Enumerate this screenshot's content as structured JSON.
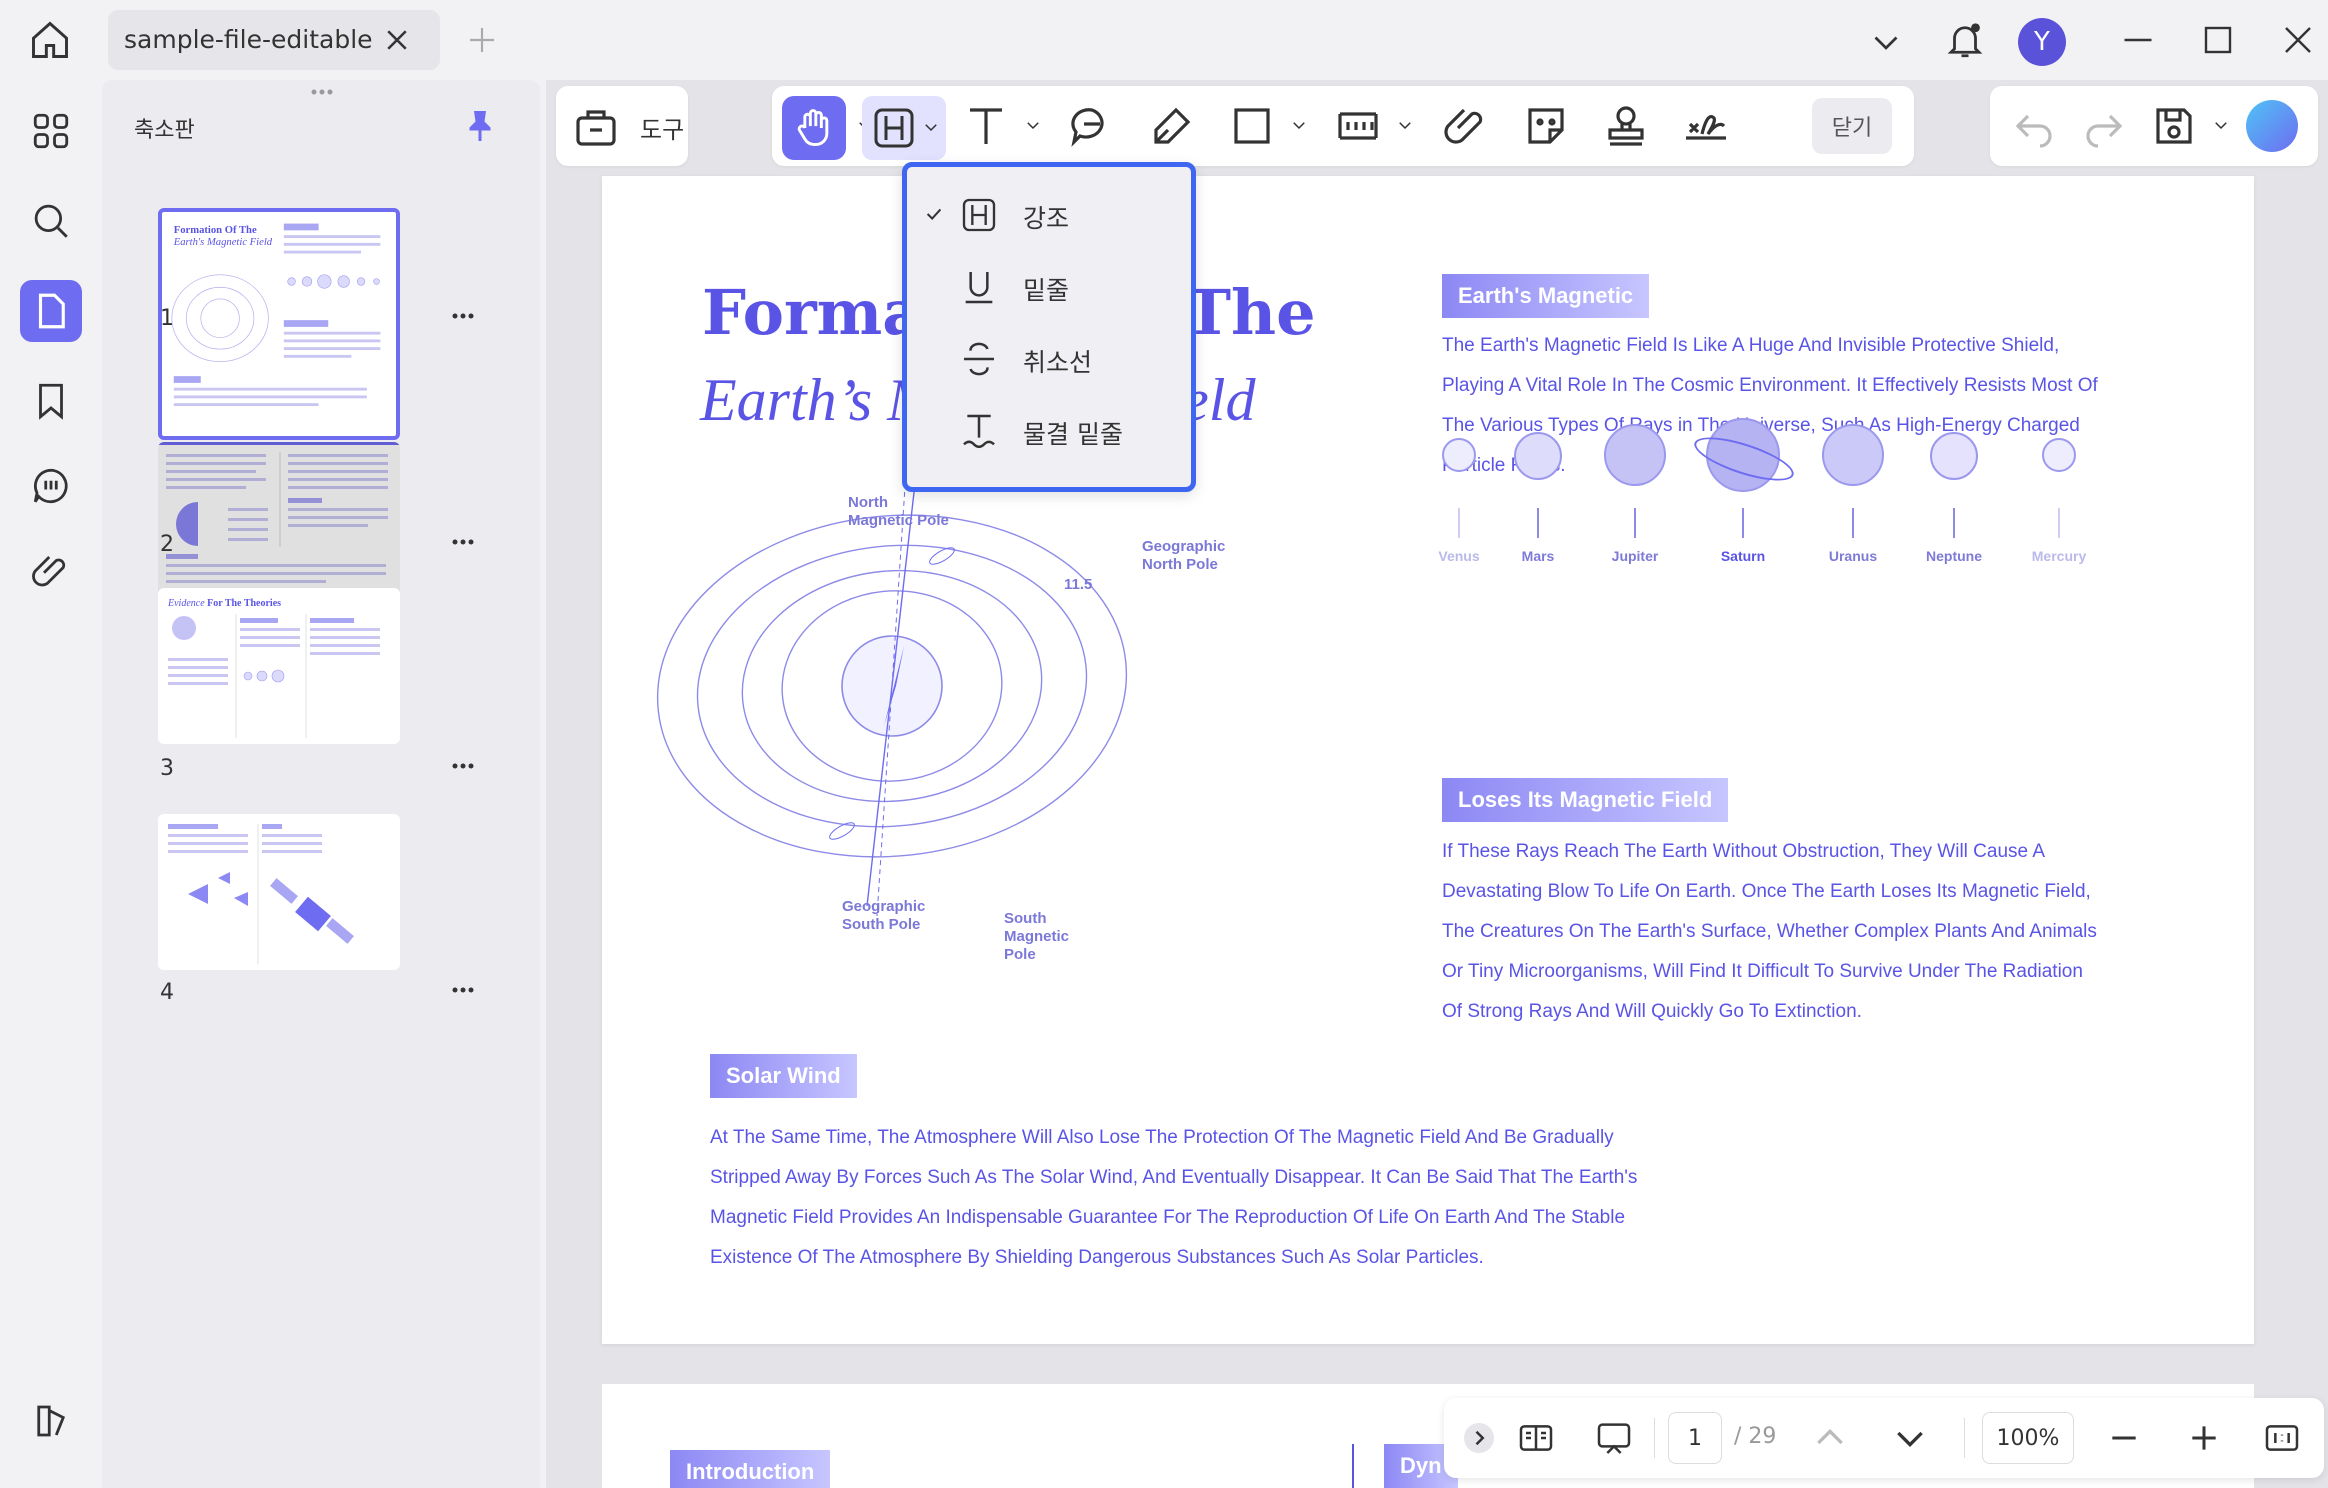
{
  "titlebar": {
    "tab_title": "sample-file-editable",
    "avatar_letter": "Y"
  },
  "panel": {
    "title": "축소판",
    "pages": [
      {
        "num": "1",
        "selected": true
      },
      {
        "num": "2",
        "selected": false
      },
      {
        "num": "3",
        "selected": false
      },
      {
        "num": "4",
        "selected": false
      }
    ],
    "thumb3_heading_a": "Evidence",
    "thumb3_heading_b": "For The Theories",
    "thumb1_heading_a": "Formation Of The",
    "thumb1_heading_b": "Earth's Magnetic Field"
  },
  "toolbar": {
    "tools_label": "도구",
    "close_label": "닫기"
  },
  "highlight_menu": {
    "items": [
      {
        "label": "강조",
        "checked": true,
        "icon": "highlight-h-icon"
      },
      {
        "label": "밑줄",
        "checked": false,
        "icon": "underline-u-icon"
      },
      {
        "label": "취소선",
        "checked": false,
        "icon": "strikethrough-s-icon"
      },
      {
        "label": "물결 밑줄",
        "checked": false,
        "icon": "squiggly-t-icon"
      }
    ]
  },
  "document": {
    "title_line1": "Formation Of The",
    "title_line2": "Earth’s Magnetic Field",
    "diagram_labels": {
      "north_mag": "North\nMagnetic Pole",
      "geo_north": "Geographic\nNorth Pole",
      "angle": "11.5",
      "geo_south": "Geographic\nSouth Pole",
      "south_mag": "South\nMagnetic\nPole"
    },
    "sections": {
      "magnetic": {
        "heading": "Earth's Magnetic",
        "text": "The Earth's Magnetic Field Is Like A Huge And Invisible Protective Shield, Playing A Vital Role In The Cosmic Environment. It Effectively Resists Most Of The Various Types Of Rays in The Universe, Such As High-Energy Charged Particle Flows."
      },
      "loses": {
        "heading": "Loses Its Magnetic Field",
        "text": "If These Rays Reach The Earth Without Obstruction, They Will Cause A Devastating Blow To Life On Earth. Once The Earth Loses Its Magnetic Field, The Creatures On The Earth's Surface, Whether Complex Plants And Animals Or Tiny Microorganisms, Will Find It Difficult To Survive Under The Radiation Of Strong Rays And Will Quickly Go To Extinction."
      },
      "solar": {
        "heading": "Solar Wind",
        "text": "At The Same Time, The Atmosphere Will Also Lose The Protection Of The Magnetic Field And Be Gradually Stripped Away By Forces Such As The Solar Wind, And Eventually Disappear. It Can Be Said That The Earth's Magnetic Field Provides An Indispensable Guarantee For The Reproduction Of Life On Earth And The Stable Existence Of The Atmosphere By Shielding Dangerous Substances Such As Solar Particles."
      }
    },
    "planets": [
      "Venus",
      "Mars",
      "Jupiter",
      "Saturn",
      "Uranus",
      "Neptune",
      "Mercury"
    ],
    "page2_heading_a": "Introduction",
    "page2_heading_b": "Dyn"
  },
  "bottombar": {
    "current_page": "1",
    "total_pages": "/ 29",
    "zoom": "100%"
  }
}
